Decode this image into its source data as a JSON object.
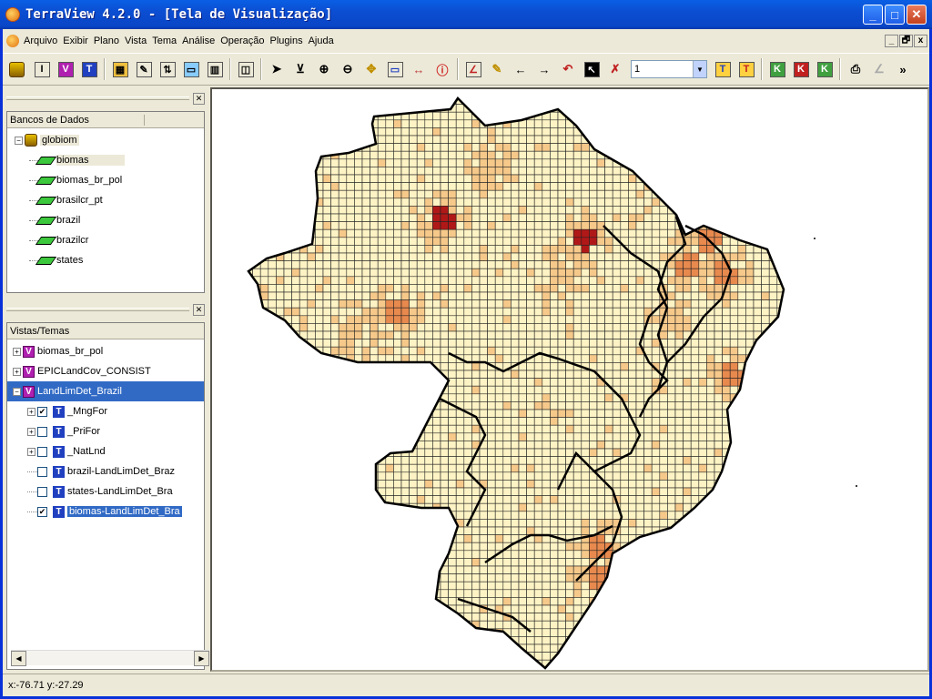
{
  "window": {
    "title": "TerraView 4.2.0 - [Tela de Visualização]"
  },
  "menu": [
    "Arquivo",
    "Exibir",
    "Plano",
    "Vista",
    "Tema",
    "Análise",
    "Operação",
    "Plugins",
    "Ajuda"
  ],
  "mdi_buttons": [
    "_",
    "🗗",
    "x"
  ],
  "toolbar": {
    "scale_value": "1"
  },
  "databases": {
    "header": "Bancos de Dados",
    "root": "globiom",
    "layers": [
      "biomas",
      "biomas_br_pol",
      "brasilcr_pt",
      "brazil",
      "brazilcr",
      "states"
    ]
  },
  "views": {
    "header": "Vistas/Temas",
    "items": [
      {
        "label": "biomas_br_pol",
        "type": "V"
      },
      {
        "label": "EPICLandCov_CONSIST",
        "type": "V"
      },
      {
        "label": "LandLimDet_Brazil",
        "type": "V",
        "selected": true
      }
    ],
    "themes": [
      {
        "label": "_MngFor",
        "checked": true,
        "expandable": true
      },
      {
        "label": "_PriFor",
        "checked": false,
        "expandable": true
      },
      {
        "label": "_NatLnd",
        "checked": false,
        "expandable": true
      },
      {
        "label": "brazil-LandLimDet_Braz",
        "checked": false
      },
      {
        "label": "states-LandLimDet_Bra",
        "checked": false
      },
      {
        "label": "biomas-LandLimDet_Bra",
        "checked": true,
        "selected": true
      }
    ]
  },
  "status": {
    "coords": "x:-76.71  y:-27.29"
  },
  "colors": {
    "accent": "#316ac5",
    "cell_base": "#fdf3c4",
    "cell_mid": "#f6c98a",
    "cell_high": "#e8894e",
    "cell_max": "#b01818"
  }
}
